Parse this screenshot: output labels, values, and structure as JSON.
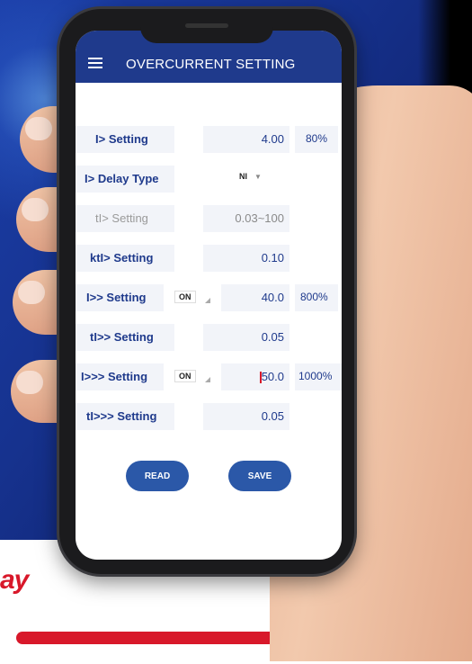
{
  "app": {
    "title": "OVERCURRENT SETTING"
  },
  "rows": [
    {
      "label": "I> Setting",
      "value": "4.00",
      "percent": "80%"
    },
    {
      "label": "I> Delay Type",
      "dropdown": "NI"
    },
    {
      "label": "tI> Setting",
      "value": "0.03~100"
    },
    {
      "label": "ktI> Setting",
      "value": "0.10"
    },
    {
      "label": "I>> Setting",
      "toggle": "ON",
      "value": "40.0",
      "percent": "800%"
    },
    {
      "label": "tI>> Setting",
      "value": "0.05"
    },
    {
      "label": "I>>> Setting",
      "toggle": "ON",
      "value": "50.0",
      "percent": "1000%"
    },
    {
      "label": "tI>>> Setting",
      "value": "0.05"
    }
  ],
  "buttons": {
    "read": "READ",
    "save": "SAVE"
  },
  "brand_fragment": "ay",
  "colors": {
    "app_bar": "#1f3a8c",
    "label": "#1f3a8c",
    "button": "#2b58a8",
    "accent_red": "#d8182a"
  }
}
